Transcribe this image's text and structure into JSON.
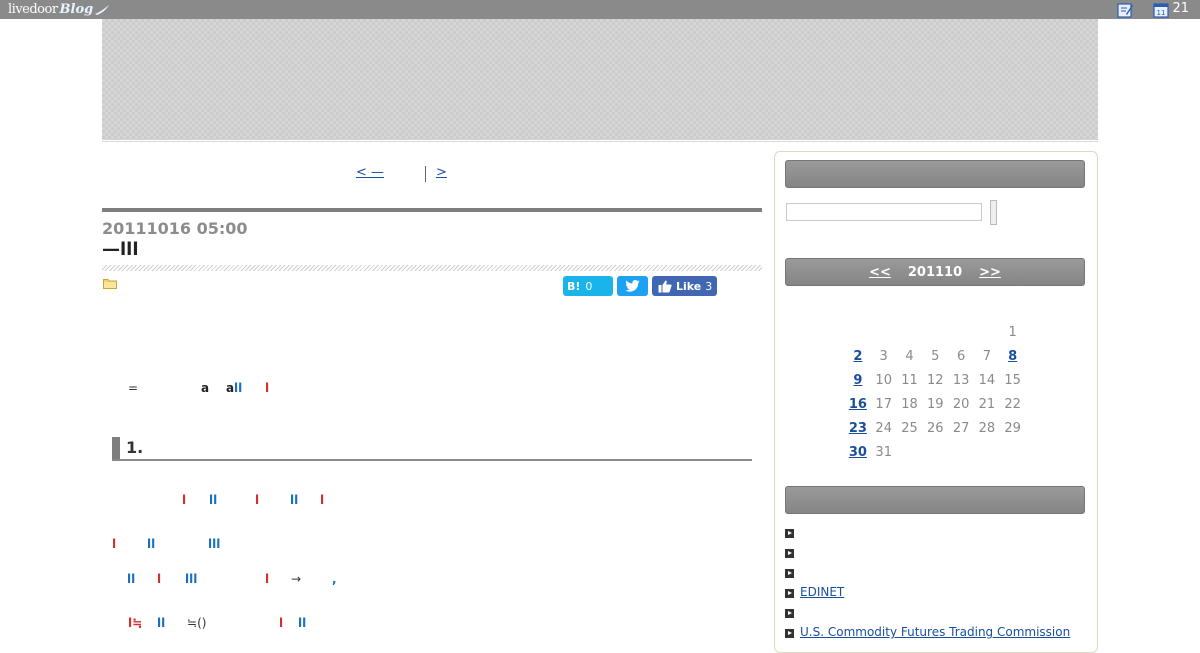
{
  "topbar": {
    "logo_text": "livedoor",
    "logo_blog": "Blog",
    "post_icon": "edit-icon",
    "calendar_icon": "calendar-icon",
    "calendar_day": "11",
    "count": "21"
  },
  "nav": {
    "prev_label": "< —",
    "next_label": ">"
  },
  "article": {
    "date": "20111016 05:00",
    "title": "—lll",
    "folder_icon": "folder-icon",
    "social": {
      "hatena_label": "B!",
      "hatena_count": "0",
      "twitter_icon": "twitter-icon",
      "like_label": "Like",
      "like_count": "3"
    },
    "intro": {
      "eq": "=",
      "a1": "a",
      "a2": "a",
      "bars1": "ll",
      "bar2": "l"
    },
    "section1": "1.",
    "lines": {
      "l1": [
        "l",
        "ll",
        "l",
        "ll",
        "l"
      ],
      "l2": [
        "l",
        "ll",
        "lll"
      ],
      "l3": [
        "ll",
        "l",
        "lll",
        "l",
        "→",
        ","
      ],
      "l4": [
        "l≒",
        "ll",
        "≒()",
        "l",
        "ll"
      ]
    }
  },
  "sidebar": {
    "calendar": {
      "prev": "<<",
      "month": "201110",
      "next": ">>",
      "weeks": [
        [
          "",
          "",
          "",
          "",
          "",
          "",
          "1"
        ],
        [
          "2",
          "3",
          "4",
          "5",
          "6",
          "7",
          "8"
        ],
        [
          "9",
          "10",
          "11",
          "12",
          "13",
          "14",
          "15"
        ],
        [
          "16",
          "17",
          "18",
          "19",
          "20",
          "21",
          "22"
        ],
        [
          "23",
          "24",
          "25",
          "26",
          "27",
          "28",
          "29"
        ],
        [
          "30",
          "31",
          "",
          "",
          "",
          "",
          ""
        ]
      ],
      "linked_days": [
        "2",
        "8",
        "9",
        "16",
        "23",
        "30"
      ]
    },
    "categories": [
      "",
      "",
      "",
      "EDINET",
      "",
      "U.S. Commodity Futures Trading Commission"
    ]
  }
}
